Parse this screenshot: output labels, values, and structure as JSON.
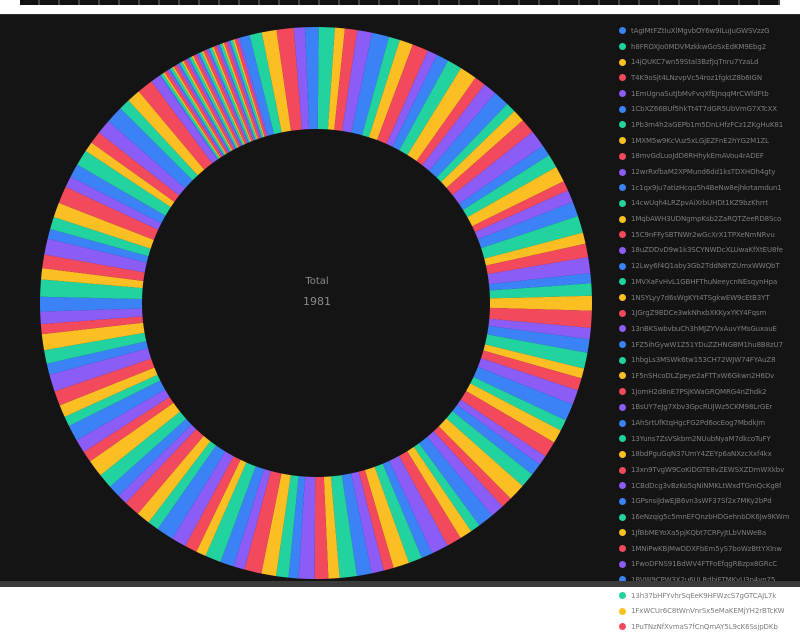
{
  "colors": [
    "#3b82f6",
    "#22d3a0",
    "#fbbf24",
    "#f2495c",
    "#8b5cf6"
  ],
  "center": {
    "label": "Total",
    "value": "1981"
  },
  "chart_data": {
    "type": "pie",
    "title": "",
    "total": 1981,
    "legend_position": "right",
    "legend": [
      "tAgIMtFZtIuXlMgvbOY6w9ILuJuGWSVzzG",
      "h8FROXJo0MDVMzkkwGoSxEdKM9Ebg2",
      "14jQUKC7wn59Stal3BzfJqTnru7YzaLd",
      "T4K9oSjt4LNzvpVc54roz1fgktZ8b6IGN",
      "1EmUgnaSutJbMvFvqXfEJnqqMrCWfdFtb",
      "1CbXZ66BUf5hkTt4T7dGR5UbVmG7XTcXX",
      "1Pb3m4h2aGEPb1m5DnLHfzFCz1ZKgHuK81",
      "1MXM5w9KcVuz5xLGjEZFnE2hYG2M1ZL",
      "18mvGdLuoJdD8RHhykEmAVou4rADEF",
      "12wrRxfbaM2XPMund6dd1ksTDXHOh4gty",
      "1c1qx9ju7atizHcqu5h4BeNw8ejhkrtamdun1",
      "14cwUqh4LRZpvAiXrbUHDt1KZ9bzKhrrt",
      "1MqbAWH3UDNgmpKsb2ZaRQTZeeRD8Sco",
      "15C9nFFySBTNWr2wGcXrX1TPXeNmNRvu",
      "18uZDDvD9w1k3SCYNWDcXLUwaKfXtEU8fe",
      "12Lwy6f4Q1aby3Gb2TddN8YZUmxWWQbT",
      "1MVXaFvHvL1GBHFThuNeeycnNEsqynHpa",
      "1NSYLyy7d6sWgKYt4TSgkwEW9cEtB3YT",
      "1JGrgZ9BDCe3wkNhxbXKKyxYKY4Fqsm",
      "13nBKSwbvbuCh3hMJZYVxAuvYMsGuxauE",
      "1FZ5ihGywW1Z51YDuZZHNGBM1hu8B8zU7",
      "1hbgLs3MSWk6tw153CH72WJW74FYAuZ8",
      "1F5nSHcoDLZpeye2aFTTxW6Gkwn2H6Dv",
      "1JomH2d8nE7PSjKWaGRQMRG4nZhdk2",
      "1BsUY7eJg7Xbv3GpcRUJWz5CKM98LrGEr",
      "1AhSrtUfKtqHgcFG2Pd6ocEog7Mbdkjm",
      "13Yuns7ZsVSkbm2NUubNyaM7dkcoTuFY",
      "18bdPguGqN37UmY4ZEYp6aNXzcXxf4kx",
      "13xn9TvgW9CoKiDGTE8vZEWSXZDmWXkbv",
      "1CBdDcg3vBzKo5qNiNMKLtWxdTGmQcKg8f",
      "1GPsnsiJdwEJB6vn3sWF37Sf2x7MKy2bPd",
      "16eNzqig5c5mnEFQnzbHDGehnbDK6Jw9KWm",
      "1JfBbMEYoXa5pjKQbt7CRFyJtLbVNWeBa",
      "1MNiPwKBjMwDDXFbEm5yS7boWzBttYXlnw",
      "1FwoDFNS91BdWV4FTFoEfqgRBzpx8GRcC",
      "1BVW9CPW3X2u6ULRdbjFTMKvU3n4vn75",
      "13h37bHFYvhrSqEeK9HFWzcS7gGTCAJL7k",
      "1FxWCUr6C8tWnVnrSx5eMaKEMjYH2rBTcKW",
      "1PuTNzNfXvmaS7fCnQmAY5L9cK6SsjpDKb"
    ]
  }
}
